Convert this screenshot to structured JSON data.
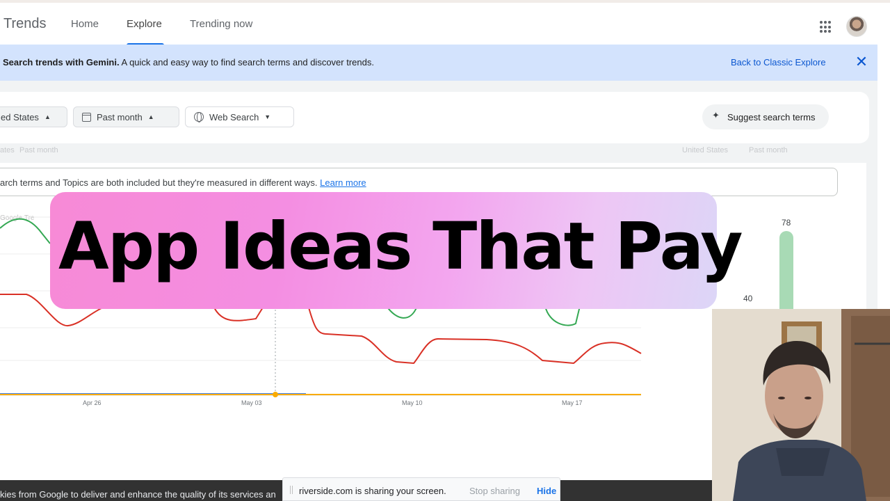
{
  "header": {
    "brand": "Trends",
    "nav": [
      {
        "label": "Home",
        "active": false
      },
      {
        "label": "Explore",
        "active": true
      },
      {
        "label": "Trending now",
        "active": false
      }
    ],
    "apps_icon": "grid-apps-icon",
    "avatar_icon": "account-avatar"
  },
  "banner": {
    "title": "Search trends with Gemini.",
    "text": " A quick and easy way to find search terms and discover trends.",
    "link": "Back to Classic Explore",
    "close": "✕",
    "bg_color": "#d3e3fd"
  },
  "filters": {
    "region": "ed States",
    "period": "Past month",
    "property": "Web Search",
    "suggest_label": "Suggest search terms"
  },
  "faint_row": {
    "left_a": "ates",
    "left_b": "Past month",
    "right_a": "United States",
    "right_b": "Past month"
  },
  "notice": {
    "text": "arch terms and Topics are both included but they're measured in different ways.",
    "link": "Learn more"
  },
  "chart_data": {
    "type": "line",
    "x": [
      "Apr 26",
      "May 03",
      "May 10",
      "May 17"
    ],
    "watermark": "Google Tre",
    "series": [
      {
        "color": "#34a853"
      },
      {
        "color": "#d93025"
      },
      {
        "color": "#4285f4"
      },
      {
        "color": "#f9ab00"
      }
    ],
    "bar_values": [
      78,
      40
    ]
  },
  "overlay": {
    "title": "App Ideas That Pay"
  },
  "cookie": {
    "text": "kies from Google to deliver and enhance the quality of its services an"
  },
  "screen_share": {
    "text": "riverside.com is sharing your screen.",
    "stop": "Stop sharing",
    "hide": "Hide"
  }
}
